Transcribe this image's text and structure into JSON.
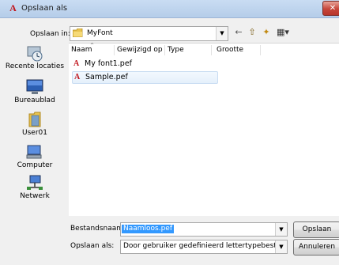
{
  "window": {
    "title": "Opslaan als",
    "app_icon": "A",
    "close_label": "✕"
  },
  "lookin": {
    "label": "Opslaan in:",
    "value": "MyFont"
  },
  "toolbar": {
    "back": "←",
    "up": "⇧",
    "new_folder": "✦",
    "view": "▦▾"
  },
  "places": [
    {
      "label": "Recente locaties",
      "icon": "recent-locations-icon"
    },
    {
      "label": "Bureaublad",
      "icon": "desktop-icon"
    },
    {
      "label": "User01",
      "icon": "user-folder-icon"
    },
    {
      "label": "Computer",
      "icon": "computer-icon"
    },
    {
      "label": "Netwerk",
      "icon": "network-icon"
    }
  ],
  "columns": {
    "name": "Naam",
    "modified": "Gewijzigd op",
    "type": "Type",
    "size": "Grootte"
  },
  "files": [
    {
      "name": "My font1.pef",
      "icon": "A"
    },
    {
      "name": "Sample.pef",
      "icon": "A"
    }
  ],
  "filename": {
    "label": "Bestandsnaam:",
    "value": "Naamloos.pef"
  },
  "saveas": {
    "label": "Opslaan als:",
    "value": "Door gebruiker gedefinieerd lettertypebestand ver. 8 ("
  },
  "buttons": {
    "save": "Opslaan",
    "cancel": "Annuleren"
  },
  "dropdown_arrow": "▼"
}
